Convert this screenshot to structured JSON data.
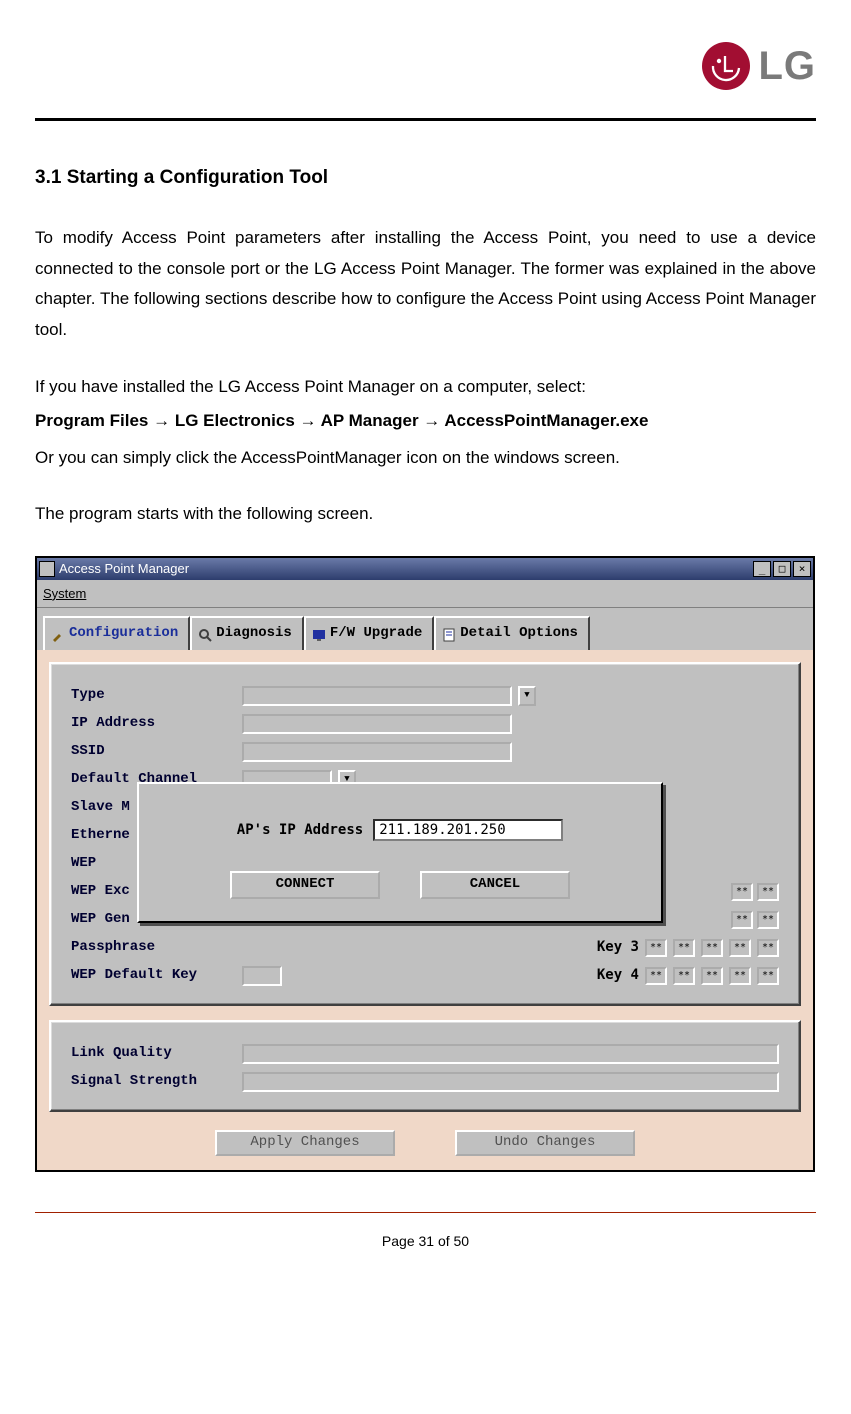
{
  "header": {
    "brand": "LG"
  },
  "section": {
    "title": "3.1 Starting a Configuration Tool",
    "p1": "To modify Access Point parameters after installing the Access Point, you need to use a device connected to the console port or the LG Access Point Manager. The former was explained in the above chapter. The following sections describe how to configure the Access Point using Access Point Manager tool.",
    "p2": "If you have installed the LG Access Point Manager on a computer, select:",
    "nav_path": "Program Files → LG Electronics → AP Manager → AccessPointManager.exe",
    "p3": "Or you can simply click the AccessPointManager icon on the windows screen.",
    "p4": "The program starts with the following screen."
  },
  "window": {
    "title": "Access Point Manager",
    "menu": {
      "item1_underline": "S",
      "item1_rest": "ystem"
    },
    "winbtns": {
      "min": "_",
      "max": "□",
      "close": "×"
    },
    "tabs": [
      {
        "label": "Configuration",
        "active": true
      },
      {
        "label": "Diagnosis",
        "active": false
      },
      {
        "label": "F/W Upgrade",
        "active": false
      },
      {
        "label": "Detail Options",
        "active": false
      }
    ],
    "form_labels": {
      "type": "Type",
      "ip": "IP Address",
      "ssid": "SSID",
      "channel": "Default Channel",
      "slave": "Slave M",
      "eth": "Etherne",
      "wep": "WEP",
      "wep_excl": "WEP Exc",
      "wep_gen": "WEP Gen",
      "passphrase": "Passphrase",
      "wep_default": "WEP Default Key",
      "link_quality": "Link Quality",
      "signal": "Signal Strength"
    },
    "keys": {
      "k3": "Key 3",
      "k4": "Key 4",
      "mask": "**"
    },
    "buttons": {
      "apply": "Apply Changes",
      "undo": "Undo Changes"
    }
  },
  "dialog": {
    "label": "AP's IP Address",
    "value": "211.189.201.250",
    "connect": "CONNECT",
    "cancel": "CANCEL"
  },
  "footer": {
    "page": "Page 31 of 50"
  }
}
